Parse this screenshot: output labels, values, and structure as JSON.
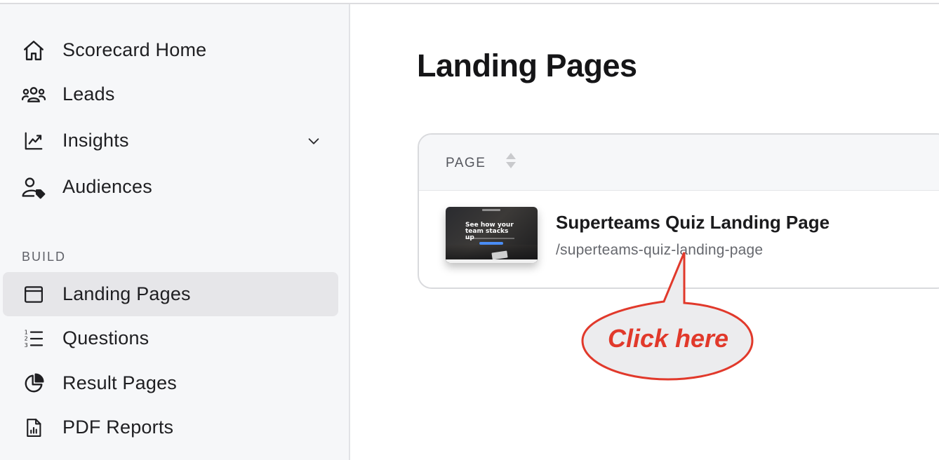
{
  "sidebar": {
    "nav_items": [
      {
        "label": "Scorecard Home",
        "icon": "home-icon"
      },
      {
        "label": "Leads",
        "icon": "users-icon"
      },
      {
        "label": "Insights",
        "icon": "chart-line-icon",
        "expandable": true
      },
      {
        "label": "Audiences",
        "icon": "user-tag-icon"
      }
    ],
    "build_section_label": "BUILD",
    "build_items": [
      {
        "label": "Landing Pages",
        "icon": "browser-window-icon",
        "active": true
      },
      {
        "label": "Questions",
        "icon": "numbered-list-icon"
      },
      {
        "label": "Result Pages",
        "icon": "pie-chart-icon"
      },
      {
        "label": "PDF Reports",
        "icon": "pdf-report-icon"
      }
    ]
  },
  "main": {
    "title": "Landing Pages",
    "table": {
      "column_header": "PAGE",
      "rows": [
        {
          "title": "Superteams Quiz Landing Page",
          "slug": "/superteams-quiz-landing-page",
          "thumbnail_headline": "See how your team stacks up"
        }
      ]
    }
  },
  "annotation": {
    "callout_text": "Click here",
    "color": "#e1392b"
  },
  "colors": {
    "sidebar_bg": "#f6f7f9",
    "active_item_bg": "#e6e6e9",
    "accent_red": "#e1392b"
  }
}
